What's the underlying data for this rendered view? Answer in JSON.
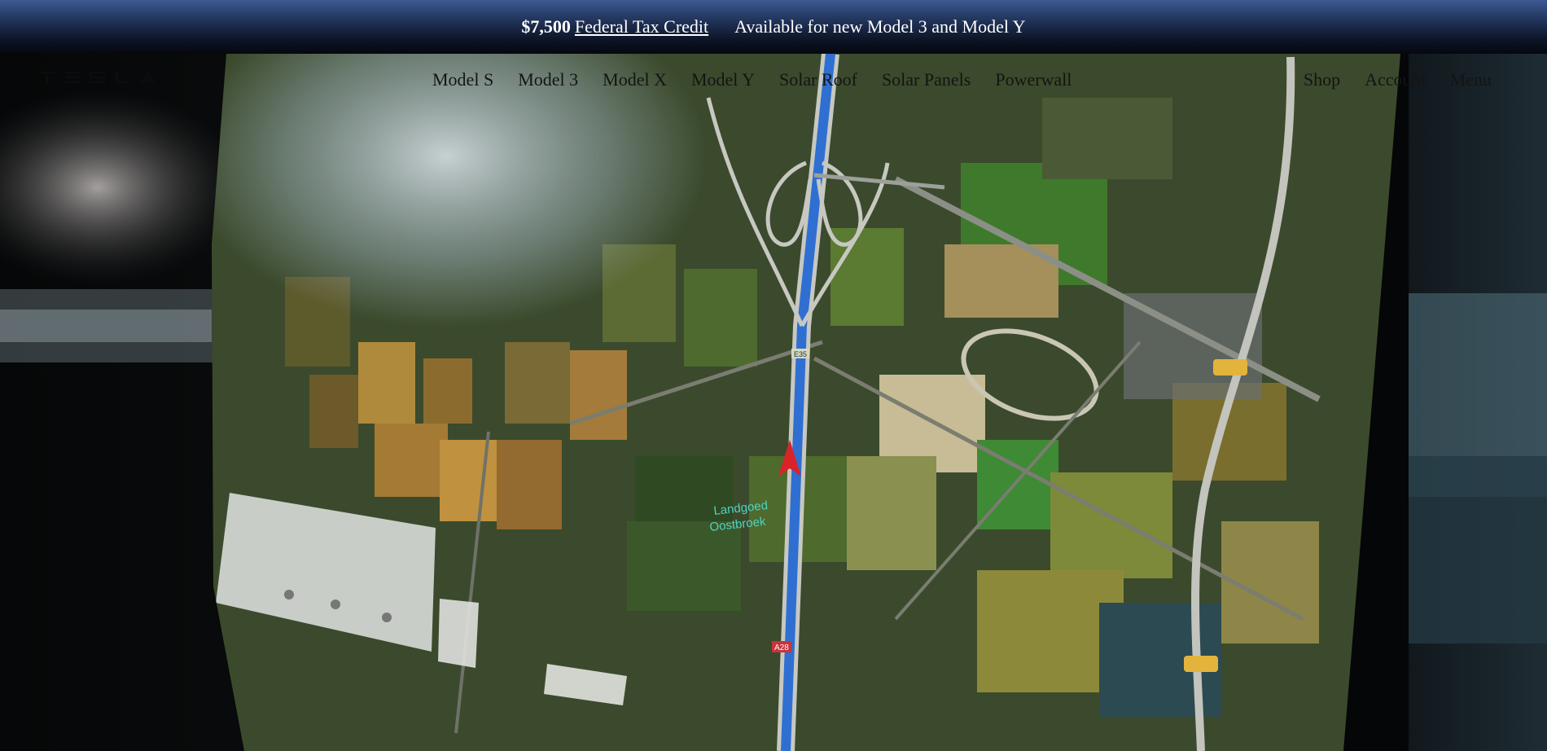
{
  "promo": {
    "amount": "$7,500",
    "link_text": " Federal Tax Credit",
    "availability": "Available for new Model 3 and Model Y"
  },
  "nav": {
    "logo_name": "TESLA",
    "items": [
      "Model S",
      "Model 3",
      "Model X",
      "Model Y",
      "Solar Roof",
      "Solar Panels",
      "Powerwall"
    ],
    "right": [
      "Shop",
      "Account",
      "Menu"
    ]
  },
  "hero": {
    "map_label_line1": "Landgoed",
    "map_label_line2": "Oostbroek",
    "road_shield_top": "E35",
    "road_shield_bottom": "A28",
    "route_color": "#2f6fd1",
    "nav_arrow_color": "#d8232a"
  }
}
